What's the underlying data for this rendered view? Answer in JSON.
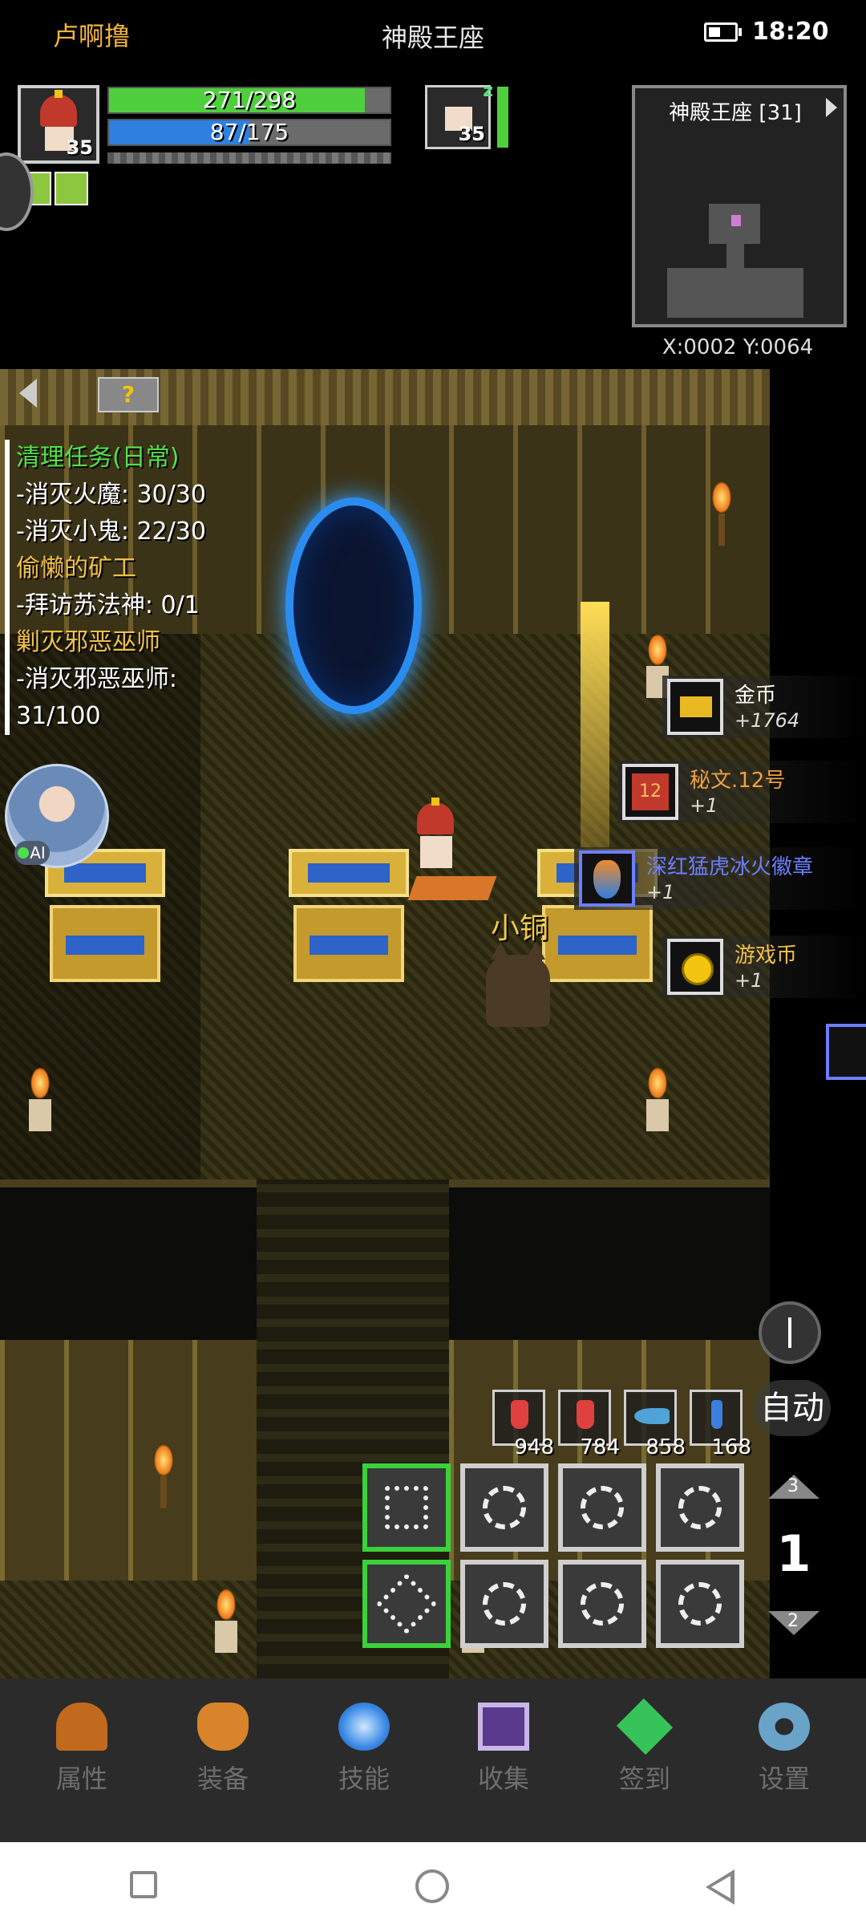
{
  "status_bar": {
    "player_name": "卢啊撸",
    "map_title": "神殿王座",
    "time": "18:20"
  },
  "hud": {
    "player_level": "35",
    "hp_text": "271/298",
    "hp_fraction": 0.91,
    "mp_text": "87/175",
    "mp_fraction": 0.5,
    "pet_level": "35",
    "pet_status": "z"
  },
  "minimap": {
    "title": "神殿王座 [31]",
    "coords": "X:0002  Y:0064"
  },
  "quests": {
    "help_label": "?",
    "lines": [
      {
        "text": "清理任务(日常)",
        "color": "#53e04c"
      },
      {
        "text": "-消灭火魔: 30/30",
        "color": "#ffffff"
      },
      {
        "text": "-消灭小鬼: 22/30",
        "color": "#ffffff"
      },
      {
        "text": "偷懒的矿工",
        "color": "#f0c04a"
      },
      {
        "text": "-拜访苏法神: 0/1",
        "color": "#ffffff"
      },
      {
        "text": "剿灭邪恶巫师",
        "color": "#f0c04a"
      },
      {
        "text": "-消灭邪恶巫师:",
        "color": "#ffffff"
      },
      {
        "text": "31/100",
        "color": "#ffffff"
      }
    ]
  },
  "ai_badge": "AI",
  "pet": {
    "name": "小铜"
  },
  "loot": [
    {
      "name": "金币",
      "count": "+1764",
      "name_color": "#ffffff",
      "icon": "gold-bars-icon"
    },
    {
      "name": "秘文.12号",
      "count": "+1",
      "name_color": "#f0a040",
      "icon": "rune-12-icon"
    },
    {
      "name": "深红猛虎冰火徽章",
      "count": "+1",
      "name_color": "#6b7fff",
      "icon": "badge-icon"
    },
    {
      "name": "游戏币",
      "count": "+1",
      "name_color": "#f0c04a",
      "icon": "coin-icon"
    }
  ],
  "controls": {
    "auto_label": "自动",
    "page_up": "3",
    "page_current": "1",
    "page_down": "2"
  },
  "potions": [
    {
      "count": "948",
      "color": "#e04040",
      "icon": "red-potion-icon"
    },
    {
      "count": "784",
      "color": "#e04040",
      "icon": "red-potion-icon"
    },
    {
      "count": "858",
      "color": "#4fa3d8",
      "icon": "fish-icon"
    },
    {
      "count": "168",
      "color": "#3b7fe0",
      "icon": "blue-potion-icon"
    }
  ],
  "bottom_nav": [
    {
      "label": "属性",
      "icon": "helmet-icon"
    },
    {
      "label": "装备",
      "icon": "bag-icon"
    },
    {
      "label": "技能",
      "icon": "skill-gem-icon"
    },
    {
      "label": "收集",
      "icon": "book-icon"
    },
    {
      "label": "签到",
      "icon": "emerald-icon"
    },
    {
      "label": "设置",
      "icon": "gear-icon"
    }
  ]
}
